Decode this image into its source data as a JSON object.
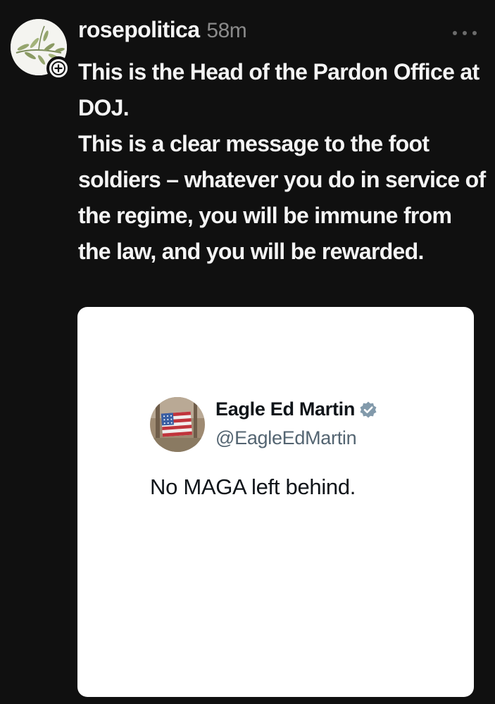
{
  "post": {
    "username": "rosepolitica",
    "timestamp": "58m",
    "icons": {
      "avatar": "olive-branch-avatar",
      "follow": "plus-icon",
      "more": "more-horizontal-icon"
    },
    "text_lines": [
      "This is the Head of the Pardon Office at DOJ.",
      "This is a clear message to the foot soldiers – whatever you do in service of the regime, you will be immune from the law, and you will be rewarded."
    ]
  },
  "embed": {
    "name": "Eagle Ed Martin",
    "handle": "@EagleEdMartin",
    "text": "No MAGA left behind.",
    "icons": {
      "avatar": "american-flag-avatar",
      "verified": "verified-badge-icon"
    }
  },
  "colors": {
    "background": "#101010",
    "text": "#f4f4f4",
    "muted": "#8a8a8a",
    "card_background": "#ffffff",
    "card_handle": "#536471",
    "verified": "#829aab"
  }
}
